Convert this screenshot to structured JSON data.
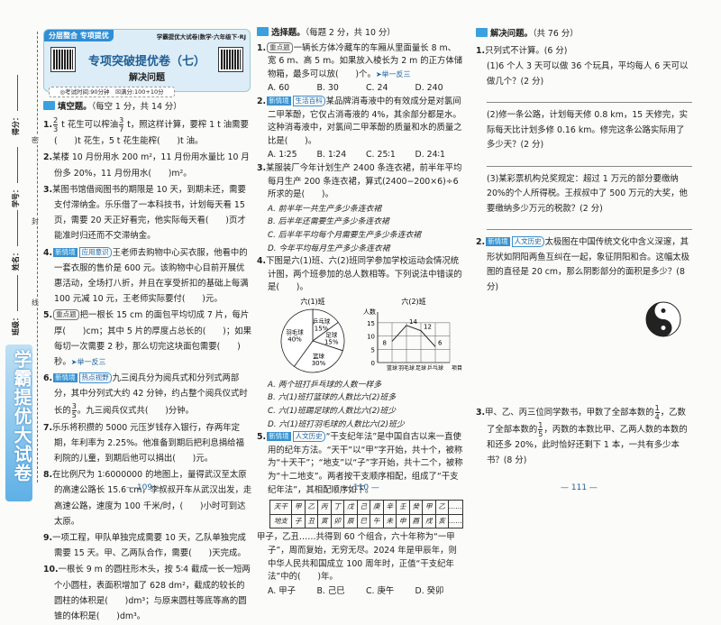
{
  "margin": {
    "fields": [
      "得分：",
      "学号：",
      "姓名：",
      "班级："
    ],
    "cut_marks": [
      "密",
      "封",
      "线"
    ],
    "banner": "学霸提优大试卷"
  },
  "header": {
    "tab": "分层整合 专项提优",
    "series": "学霸提优大试卷|数学·六年级下·RJ",
    "title": "专项突破提优卷（七）",
    "subtitle": "解决问题",
    "info": "◎考试时间:90分钟　☒满分:100+10分"
  },
  "page_numbers": [
    "— 109 —",
    "— 110 —",
    "— 111 —"
  ],
  "col1": [
    {
      "t": "sec",
      "label": "填空题。",
      "note": "（每空 1 分，共 14 分）"
    },
    {
      "t": "q",
      "num": "1.",
      "text": "{2/3} t 花生可以榨油{3/7} t，照这样计算，要榨 1 t 油需要(　　)t 花生，5 t 花生能榨(　　)t 油。"
    },
    {
      "t": "q",
      "num": "2.",
      "text": "某楼 10 月份用水 200 m²，11 月份用水量比 10 月份多 20%，11 月份用水(　　)m²。"
    },
    {
      "t": "q",
      "num": "3.",
      "text": "某图书馆借阅图书的期限是 10 天，到期未还，需要支付滞纳金。乐乐借了一本科技书，计划每天看 15 页，需要 20 天正好看完，他实际每天看(　　)页才能准时归还而不交滞纳金。"
    },
    {
      "t": "q",
      "num": "4.",
      "tags": [
        [
          "dark",
          "新情境"
        ],
        [
          "light",
          "应用意识"
        ]
      ],
      "text": "王老师去购物中心买衣服，他看中的一套衣服的售价是 600 元。该购物中心目前开展优惠活动，全场打八折，并且在享受折扣的基础上每满 100 元减 10 元，王老师实际要付(　　)元。"
    },
    {
      "t": "q",
      "num": "5.",
      "tags": [
        [
          "gray",
          "重点题"
        ]
      ],
      "text": "把一根长 15 cm 的面包平均切成 7 片，每片厚(　　)cm；其中 5 片的厚度占总长的(　　)；如果每切一次需要 2 秒，那么切完这块面包需要(　　)秒。",
      "ext": "➤举一反三"
    },
    {
      "t": "q",
      "num": "6.",
      "tags": [
        [
          "dark",
          "新情境"
        ],
        [
          "light",
          "热点视野"
        ]
      ],
      "text": "九三阅兵分为阅兵式和分列式两部分，其中分列式大约 42 分钟，约占整个阅兵仪式时长的{3/5}。九三阅兵仪式共(　　)分钟。"
    },
    {
      "t": "q",
      "num": "7.",
      "text": "乐乐将积攒的 5000 元压岁钱存入银行，存两年定期，年利率为 2.25%。他准备到期后把利息捐给福利院的儿童，到期后他可以捐出(　　)元。"
    },
    {
      "t": "q",
      "num": "8.",
      "text": "在比例尺为 1∶6000000 的地图上，量得武汉至太原的高速公路长 15.6 cm，李叔叔开车从武汉出发，走高速公路，速度为 100 千米/时，(　　)小时可到达太原。"
    },
    {
      "t": "q",
      "num": "9.",
      "text": "一项工程，甲队单独完成需要 10 天，乙队单独完成需要 15 天。甲、乙两队合作，需要(　　)天完成。"
    },
    {
      "t": "q",
      "num": "10.",
      "text": "一根长 9 m 的圆柱形木头，按 5∶4 截成一长一短两个小圆柱，表面积增加了 628 dm²，截成的较长的圆柱的体积是(　　)dm³；与原来圆柱等底等高的圆锥的体积是(　　)dm³。"
    }
  ],
  "col2": [
    {
      "t": "sec",
      "label": "选择题。",
      "note": "（每题 2 分，共 10 分）"
    },
    {
      "t": "q",
      "num": "1.",
      "tags": [
        [
          "gray",
          "重点题"
        ]
      ],
      "text": "一辆长方体冷藏车的车厢从里面量长 8 m、宽 6 m、高 5 m。如果放入棱长为 2 m 的正方体储物箱，最多可以放(　　)个。",
      "ext": "➤举一反三"
    },
    {
      "t": "opts",
      "items": [
        "A. 60",
        "B. 30",
        "C. 24",
        "D. 240"
      ]
    },
    {
      "t": "q",
      "num": "2.",
      "tags": [
        [
          "dark",
          "新情境"
        ],
        [
          "light",
          "生活百科"
        ]
      ],
      "text": "某品牌消毒液中的有效成分是对氯间二甲苯酚，它仅占消毒液的 4%，其余部分都是水。这种消毒液中，对氯间二甲苯酚的质量和水的质量之比是(　　)。"
    },
    {
      "t": "opts",
      "items": [
        "A. 1∶25",
        "B. 1∶24",
        "C. 25∶1",
        "D. 24∶1"
      ]
    },
    {
      "t": "q",
      "num": "3.",
      "text": "某服装厂今年计划生产 2400 条连衣裙，前半年平均每月生产 200 条连衣裙，算式(2400−200×6)÷6 所求的是(　　)。"
    },
    {
      "t": "optv",
      "text": "A. 前半年一共生产多少条连衣裙"
    },
    {
      "t": "optv",
      "text": "B. 后半年还需要生产多少条连衣裙"
    },
    {
      "t": "optv",
      "text": "C. 后半年平均每个月需要生产多少条连衣裙"
    },
    {
      "t": "optv",
      "text": "D. 今年平均每月生产多少条连衣裙"
    },
    {
      "t": "q",
      "num": "4.",
      "text": "下图是六(1)班、六(2)班同学参加学校运动会情况统计图，两个班参加的总人数相等。下列说法中错误的是(　　)。"
    },
    {
      "t": "charts"
    },
    {
      "t": "optv",
      "text": "A. 两个班打乒乓球的人数一样多"
    },
    {
      "t": "optv",
      "text": "B. 六(1)班打篮球的人数比六(2)班多"
    },
    {
      "t": "optv",
      "text": "C. 六(1)班踢足球的人数比六(2)班少"
    },
    {
      "t": "optv",
      "text": "D. 六(1)班打羽毛球的人数比六(2)班少"
    },
    {
      "t": "q",
      "num": "5.",
      "tags": [
        [
          "dark",
          "新情境"
        ],
        [
          "light",
          "人文历史"
        ]
      ],
      "text": "“干支纪年法”是中国自古以来一直使用的纪年方法。“天干”以“甲”字开始，共十个，被称为“十天干”；“地支”以“子”字开始，共十二个，被称为“十二地支”。两者按干支顺序相配，组成了“干支纪年法”，其相配顺序如下。"
    },
    {
      "t": "table"
    },
    {
      "t": "q",
      "num": "",
      "text": "甲子，乙丑……共得到 60 个组合，六十年称为“一甲子”，周而复始，无穷无尽。2024 年是甲辰年，则中华人民共和国成立 100 周年时，正值“干支纪年法”中的(　　)年。"
    },
    {
      "t": "opts",
      "items": [
        "A. 甲子",
        "B. 己巳",
        "C. 庚午",
        "D. 癸卯"
      ]
    }
  ],
  "col3": [
    {
      "t": "sec",
      "label": "解决问题。",
      "note": "（共 76 分）"
    },
    {
      "t": "q",
      "num": "1.",
      "text": "只列式不计算。(6 分)"
    },
    {
      "t": "sub",
      "text": "(1)6 个人 3 天可以做 36 个玩具，平均每人 6 天可以做几个？(2 分)"
    },
    {
      "t": "line"
    },
    {
      "t": "sub",
      "text": "(2)修一条公路，计划每天修 0.8 km，15 天修完，实际每天比计划多修 0.16 km。修完这条公路实际用了多少天？(2 分)"
    },
    {
      "t": "line"
    },
    {
      "t": "sub",
      "text": "(3)某彩票机构兑奖规定：超过 1 万元的部分要缴纳 20%的个人所得税。王叔叔中了 500 万元的大奖，他要缴纳多少万元的税款？(2 分)"
    },
    {
      "t": "line"
    },
    {
      "t": "q",
      "num": "2.",
      "tags": [
        [
          "dark",
          "新情境"
        ],
        [
          "light",
          "人文历史"
        ]
      ],
      "text": "太极图在中国传统文化中含义深邃，其形状如阴阳两鱼互纠在一起，象征阴阳和合。这幅太极图的直径是 20 cm，那么阴影部分的面积是多少？(8 分)"
    },
    {
      "t": "yinyang"
    },
    {
      "t": "q",
      "num": "3.",
      "text": "甲、乙、丙三位同学数书，甲数了全部本数的{1/4}，乙数了全部本数的{1/5}，丙数的本数比甲、乙两人数的本数的和还多 20%，此时恰好还剩下 1 本，一共有多少本书？(8 分)"
    }
  ],
  "chart_pie": {
    "title": "六(1)班",
    "slices": [
      {
        "label": "乒乓球",
        "value": 15
      },
      {
        "label": "足球",
        "value": 15
      },
      {
        "label": "篮球",
        "value": 30
      },
      {
        "label": "羽毛球",
        "value": 40
      }
    ]
  },
  "chart_line": {
    "title": "六(2)班",
    "ylabel": "人数",
    "xlabel": "项目",
    "yticks": [
      0,
      5,
      10,
      15
    ],
    "ylim": [
      0,
      17
    ],
    "categories": [
      "篮球",
      "羽毛球",
      "足球",
      "乒乓球"
    ],
    "values": [
      8,
      14,
      12,
      6
    ]
  },
  "ganzhi": {
    "rows": [
      [
        "天干",
        "甲",
        "乙",
        "丙",
        "丁",
        "戊",
        "己",
        "庚",
        "辛",
        "壬",
        "癸",
        "甲",
        "乙",
        "……"
      ],
      [
        "地支",
        "子",
        "丑",
        "寅",
        "卯",
        "辰",
        "巳",
        "午",
        "未",
        "申",
        "酉",
        "戌",
        "亥",
        "……"
      ]
    ]
  }
}
